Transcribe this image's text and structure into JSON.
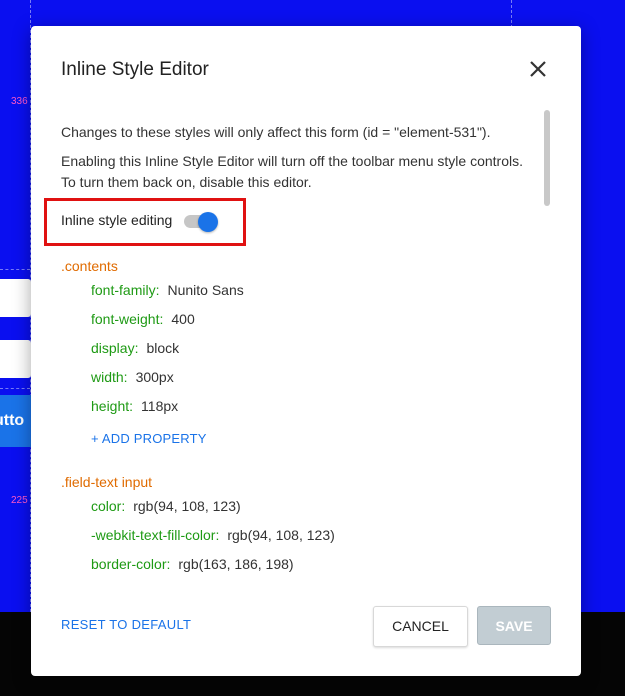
{
  "background": {
    "markers": [
      "336",
      "225"
    ],
    "button_fragment": "utto"
  },
  "modal": {
    "title": "Inline Style Editor",
    "close_icon": "close-icon",
    "paragraph1": "Changes to these styles will only affect this form (id = \"element-531\").",
    "paragraph2": "Enabling this Inline Style Editor will turn off the toolbar menu style controls. To turn them back on, disable this editor.",
    "toggle": {
      "label": "Inline style editing",
      "on": true
    },
    "sections": [
      {
        "selector": ".contents",
        "properties": [
          {
            "name": "font-family:",
            "value": "Nunito Sans"
          },
          {
            "name": "font-weight:",
            "value": "400"
          },
          {
            "name": "display:",
            "value": "block"
          },
          {
            "name": "width:",
            "value": "300px"
          },
          {
            "name": "height:",
            "value": "118px"
          }
        ],
        "add_label": "+ ADD PROPERTY"
      },
      {
        "selector": ".field-text input",
        "properties": [
          {
            "name": "color:",
            "value": "rgb(94, 108, 123)"
          },
          {
            "name": "-webkit-text-fill-color:",
            "value": "rgb(94, 108, 123)"
          },
          {
            "name": "border-color:",
            "value": "rgb(163, 186, 198)"
          }
        ]
      }
    ],
    "footer": {
      "reset_label": "RESET TO DEFAULT",
      "cancel_label": "CANCEL",
      "save_label": "SAVE",
      "save_enabled": false
    }
  },
  "colors": {
    "accent": "#1a73e8",
    "selector": "#e06b00",
    "property_key": "#1e9a14",
    "highlight_box": "#e01111",
    "backdrop": "#0a0ff0"
  }
}
